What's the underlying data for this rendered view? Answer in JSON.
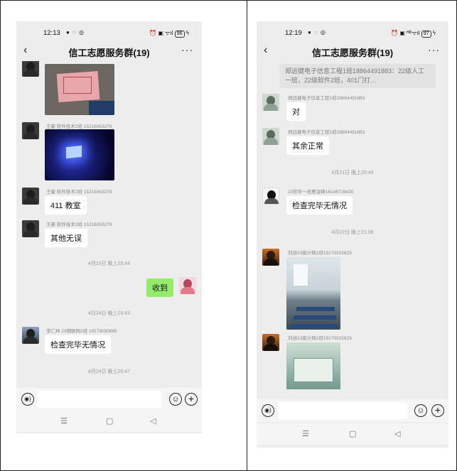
{
  "left": {
    "status": {
      "time": "12:13",
      "notif": "● ◌ ◎",
      "icons": "⏰ ▣ ᯤıl",
      "battery": "96"
    },
    "title": "信工志愿服务群(19)",
    "back_icon": "chevron-left-icon",
    "more_label": "···",
    "messages": {
      "m1_sender": "王豪 软件技术2班 15216063279",
      "m2_sender": "王豪 软件技术2班 15216063279",
      "m2_text": "411 教室",
      "m3_sender": "王豪 软件技术2班 15216063279",
      "m3_text": "其他无误",
      "ts1": "4月23日 晚上20:44",
      "mine_text": "收到",
      "ts2": "4月24日 晚上20:43",
      "m4_sender": "李仁林 23物联网1班 19179030895",
      "m4_text": "检查完毕无情况",
      "ts3": "4月24日 晚上20:47"
    },
    "nav": {
      "menu": "☰",
      "home": "▢",
      "back": "◁"
    }
  },
  "right": {
    "status": {
      "time": "12:19",
      "notif": "● ◌ ◎",
      "icons": "⏰ ▣ ᴴᴰᯤıl",
      "battery": "97"
    },
    "title": "信工志愿服务群(19)",
    "more_label": "···",
    "notice_text": "郑远健电子信息工程1班18864491883：22级人工一班，22级软件2班，401门打…",
    "messages": {
      "m1_sender": "郑远健电子信息工程1班18864491883",
      "m1_text": "对",
      "m2_sender": "郑远健电子信息工程1班18864491883",
      "m2_text": "其余正常",
      "ts1": "4月21日 晚上20:43",
      "m3_sender": "23软件一班曹凌峰18146728435",
      "m3_text": "检查完毕无情况",
      "ts2": "4月22日 晚上21:08",
      "m4_sender": "刘逊23级计网1班19179315823",
      "m5_sender": "刘逊23级计网1班19179315823"
    },
    "nav": {
      "menu": "☰",
      "home": "▢",
      "back": "◁"
    }
  },
  "input": {
    "voice_glyph": "◉)",
    "emoji_glyph": "☺",
    "plus_glyph": "+"
  }
}
